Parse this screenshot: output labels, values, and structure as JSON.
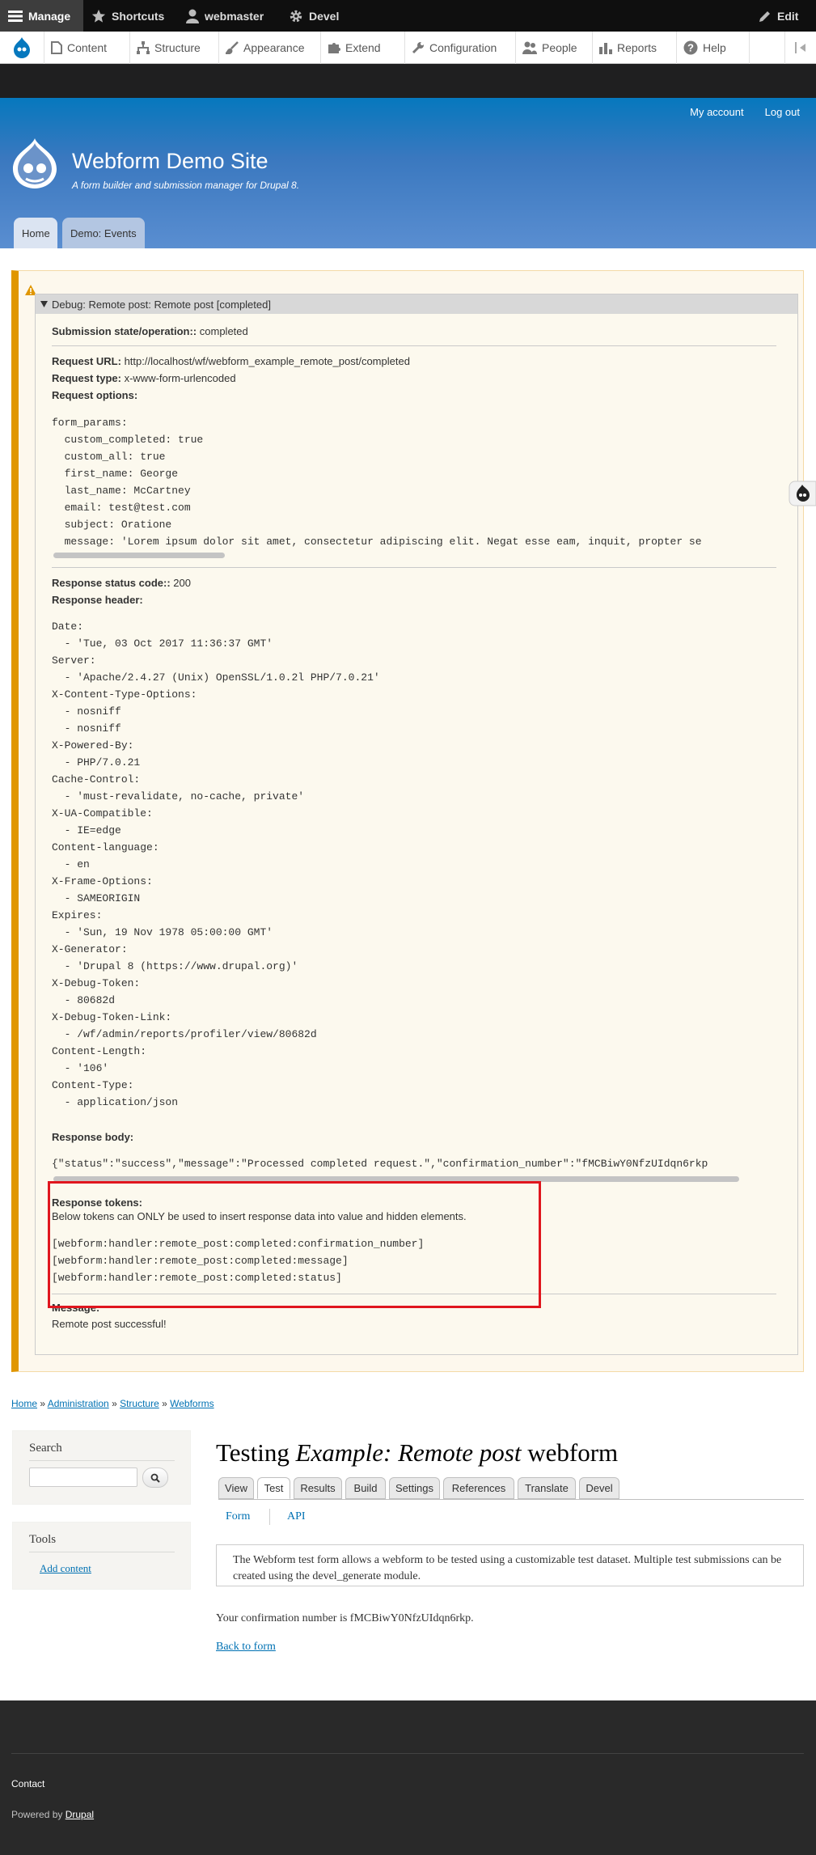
{
  "toolbar": {
    "manage": "Manage",
    "shortcuts": "Shortcuts",
    "user": "webmaster",
    "devel": "Devel",
    "edit": "Edit"
  },
  "tray": {
    "items": [
      "Content",
      "Structure",
      "Appearance",
      "Extend",
      "Configuration",
      "People",
      "Reports",
      "Help"
    ]
  },
  "header": {
    "my_account": "My account",
    "log_out": "Log out",
    "site_name": "Webform Demo Site",
    "slogan": "A form builder and submission manager for Drupal 8.",
    "tabs": [
      "Home",
      "Demo: Events"
    ]
  },
  "debug": {
    "summary": "Debug: Remote post: Remote post [completed]",
    "state_label": "Submission state/operation::",
    "state_value": "completed",
    "request_url_label": "Request URL:",
    "request_url_value": "http://localhost/wf/webform_example_remote_post/completed",
    "request_type_label": "Request type:",
    "request_type_value": "x-www-form-urlencoded",
    "request_options_label": "Request options:",
    "request_options": "form_params:\n  custom_completed: true\n  custom_all: true\n  first_name: George\n  last_name: McCartney\n  email: test@test.com\n  subject: Oratione\n  message: 'Lorem ipsum dolor sit amet, consectetur adipiscing elit. Negat esse eam, inquit, propter se",
    "status_code_label": "Response status code::",
    "status_code_value": "200",
    "response_header_label": "Response header:",
    "response_header": "Date:\n  - 'Tue, 03 Oct 2017 11:36:37 GMT'\nServer:\n  - 'Apache/2.4.27 (Unix) OpenSSL/1.0.2l PHP/7.0.21'\nX-Content-Type-Options:\n  - nosniff\n  - nosniff\nX-Powered-By:\n  - PHP/7.0.21\nCache-Control:\n  - 'must-revalidate, no-cache, private'\nX-UA-Compatible:\n  - IE=edge\nContent-language:\n  - en\nX-Frame-Options:\n  - SAMEORIGIN\nExpires:\n  - 'Sun, 19 Nov 1978 05:00:00 GMT'\nX-Generator:\n  - 'Drupal 8 (https://www.drupal.org)'\nX-Debug-Token:\n  - 80682d\nX-Debug-Token-Link:\n  - /wf/admin/reports/profiler/view/80682d\nContent-Length:\n  - '106'\nContent-Type:\n  - application/json",
    "response_body_label": "Response body:",
    "response_body": "{\"status\":\"success\",\"message\":\"Processed completed request.\",\"confirmation_number\":\"fMCBiwY0NfzUIdqn6rkp",
    "tokens_label": "Response tokens:",
    "tokens_desc": "Below tokens can ONLY be used to insert response data into value and hidden elements.",
    "tokens": "[webform:handler:remote_post:completed:confirmation_number]\n[webform:handler:remote_post:completed:message]\n[webform:handler:remote_post:completed:status]",
    "message_label": "Message:",
    "message_value": "Remote post successful!"
  },
  "breadcrumb": [
    "Home",
    "Administration",
    "Structure",
    "Webforms"
  ],
  "sidebar": {
    "search_title": "Search",
    "tools_title": "Tools",
    "add_content": "Add content"
  },
  "main": {
    "title_prefix": "Testing ",
    "title_em": "Example: Remote post",
    "title_suffix": " webform",
    "tabs": [
      "View",
      "Test",
      "Results",
      "Build",
      "Settings",
      "References",
      "Translate",
      "Devel"
    ],
    "active_tab": "Test",
    "subtabs": [
      "Form",
      "API"
    ],
    "description": "The Webform test form allows a webform to be tested using a customizable test dataset. Multiple test submissions can be created using the devel_generate module.",
    "confirmation": "Your confirmation number is fMCBiwY0NfzUIdqn6rkp.",
    "back_link": "Back to form"
  },
  "footer": {
    "contact": "Contact",
    "powered_by": "Powered by",
    "drupal": "Drupal"
  }
}
